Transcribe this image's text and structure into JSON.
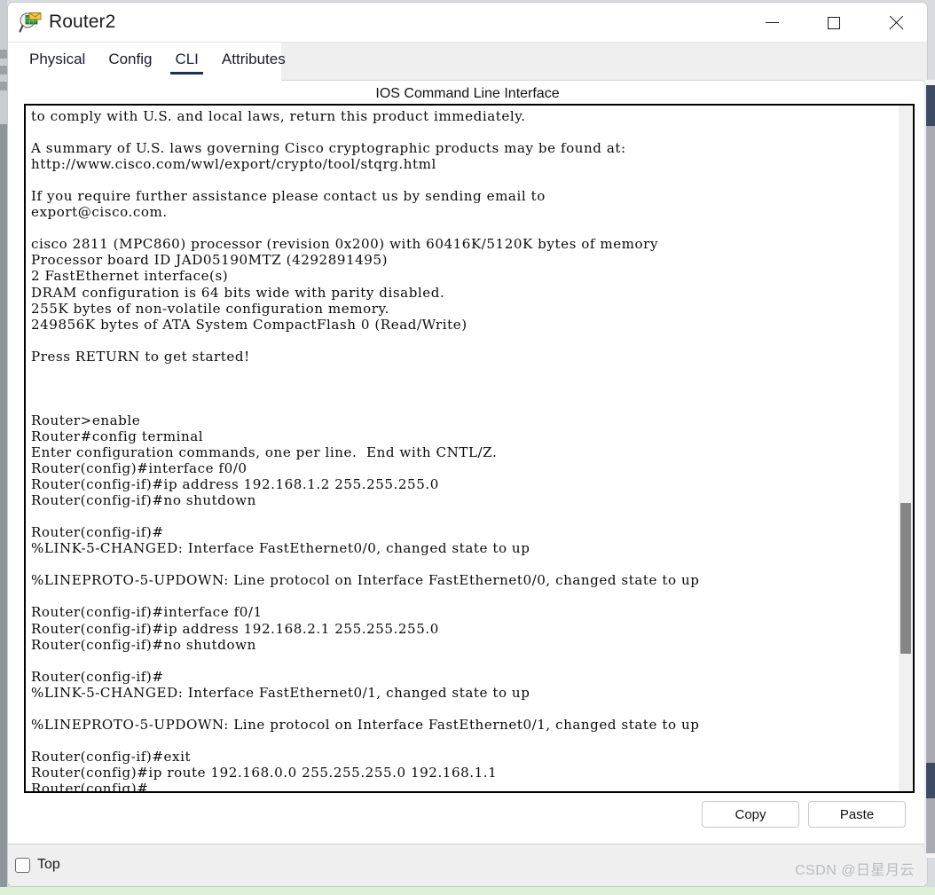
{
  "window": {
    "title": "Router2",
    "icon": "packet-tracer-icon",
    "controls": {
      "minimize": "—",
      "maximize": "□",
      "close": "✕"
    }
  },
  "tabs": [
    {
      "label": "Physical",
      "active": false
    },
    {
      "label": "Config",
      "active": false
    },
    {
      "label": "CLI",
      "active": true
    },
    {
      "label": "Attributes",
      "active": false
    }
  ],
  "panel": {
    "title": "IOS Command Line Interface"
  },
  "terminal": {
    "text": "to comply with U.S. and local laws, return this product immediately.\n\nA summary of U.S. laws governing Cisco cryptographic products may be found at:\nhttp://www.cisco.com/wwl/export/crypto/tool/stqrg.html\n\nIf you require further assistance please contact us by sending email to\nexport@cisco.com.\n\ncisco 2811 (MPC860) processor (revision 0x200) with 60416K/5120K bytes of memory\nProcessor board ID JAD05190MTZ (4292891495)\n2 FastEthernet interface(s)\nDRAM configuration is 64 bits wide with parity disabled.\n255K bytes of non-volatile configuration memory.\n249856K bytes of ATA System CompactFlash 0 (Read/Write)\n\nPress RETURN to get started!\n\n\n\nRouter>enable\nRouter#config terminal\nEnter configuration commands, one per line.  End with CNTL/Z.\nRouter(config)#interface f0/0\nRouter(config-if)#ip address 192.168.1.2 255.255.255.0\nRouter(config-if)#no shutdown\n\nRouter(config-if)#\n%LINK-5-CHANGED: Interface FastEthernet0/0, changed state to up\n\n%LINEPROTO-5-UPDOWN: Line protocol on Interface FastEthernet0/0, changed state to up\n\nRouter(config-if)#interface f0/1\nRouter(config-if)#ip address 192.168.2.1 255.255.255.0\nRouter(config-if)#no shutdown\n\nRouter(config-if)#\n%LINK-5-CHANGED: Interface FastEthernet0/1, changed state to up\n\n%LINEPROTO-5-UPDOWN: Line protocol on Interface FastEthernet0/1, changed state to up\n\nRouter(config-if)#exit\nRouter(config)#ip route 192.168.0.0 255.255.255.0 192.168.1.1\nRouter(config)#"
  },
  "buttons": {
    "copy": "Copy",
    "paste": "Paste"
  },
  "bottom": {
    "top_checkbox_label": "Top",
    "top_checkbox_checked": false,
    "watermark": "CSDN @日星月云"
  },
  "colors": {
    "accent": "#1f3057",
    "window_bg": "#ffffff",
    "tabstrip_bg": "#efefef",
    "bottombar_bg": "#efefef",
    "terminal_text": "#0b0b0b",
    "terminal_border": "#000000",
    "scrollbar_thumb": "#868686",
    "watermark": "#b9bcc0"
  }
}
